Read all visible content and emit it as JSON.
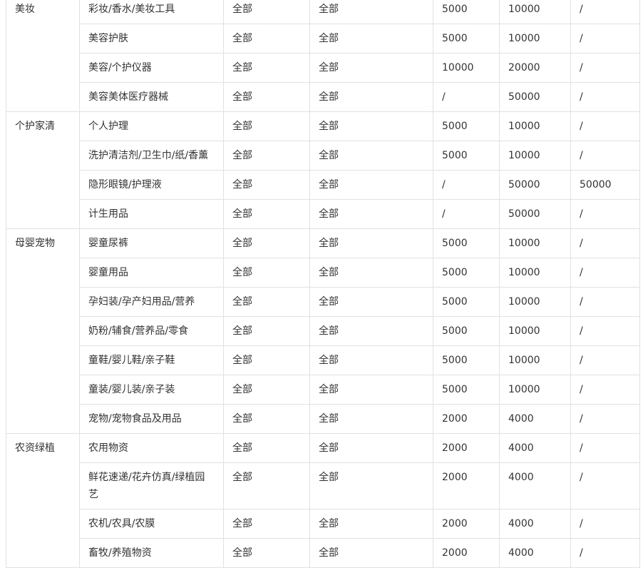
{
  "table": {
    "groups": [
      {
        "category": "美妆",
        "rows": [
          {
            "sub": "彩妆/香水/美妆工具",
            "a": "全部",
            "b": "全部",
            "c": "5000",
            "d": "10000",
            "e": "/"
          },
          {
            "sub": "美容护肤",
            "a": "全部",
            "b": "全部",
            "c": "5000",
            "d": "10000",
            "e": "/"
          },
          {
            "sub": "美容/个护仪器",
            "a": "全部",
            "b": "全部",
            "c": "10000",
            "d": "20000",
            "e": "/"
          },
          {
            "sub": "美容美体医疗器械",
            "a": "全部",
            "b": "全部",
            "c": "/",
            "d": "50000",
            "e": "/"
          }
        ]
      },
      {
        "category": "个护家清",
        "rows": [
          {
            "sub": "个人护理",
            "a": "全部",
            "b": "全部",
            "c": "5000",
            "d": "10000",
            "e": "/"
          },
          {
            "sub": "洗护清洁剂/卫生巾/纸/香薰",
            "a": "全部",
            "b": "全部",
            "c": "5000",
            "d": "10000",
            "e": "/"
          },
          {
            "sub": "隐形眼镜/护理液",
            "a": "全部",
            "b": "全部",
            "c": "/",
            "d": "50000",
            "e": "50000"
          },
          {
            "sub": "计生用品",
            "a": "全部",
            "b": "全部",
            "c": "/",
            "d": "50000",
            "e": "/"
          }
        ]
      },
      {
        "category": "母婴宠物",
        "rows": [
          {
            "sub": "婴童尿裤",
            "a": "全部",
            "b": "全部",
            "c": "5000",
            "d": "10000",
            "e": "/"
          },
          {
            "sub": "婴童用品",
            "a": "全部",
            "b": "全部",
            "c": "5000",
            "d": "10000",
            "e": "/"
          },
          {
            "sub": "孕妇装/孕产妇用品/营养",
            "a": "全部",
            "b": "全部",
            "c": "5000",
            "d": "10000",
            "e": "/"
          },
          {
            "sub": "奶粉/辅食/营养品/零食",
            "a": "全部",
            "b": "全部",
            "c": "5000",
            "d": "10000",
            "e": "/"
          },
          {
            "sub": "童鞋/婴儿鞋/亲子鞋",
            "a": "全部",
            "b": "全部",
            "c": "5000",
            "d": "10000",
            "e": "/"
          },
          {
            "sub": "童装/婴儿装/亲子装",
            "a": "全部",
            "b": "全部",
            "c": "5000",
            "d": "10000",
            "e": "/"
          },
          {
            "sub": "宠物/宠物食品及用品",
            "a": "全部",
            "b": "全部",
            "c": "2000",
            "d": "4000",
            "e": "/"
          }
        ]
      },
      {
        "category": "农资绿植",
        "rows": [
          {
            "sub": "农用物资",
            "a": "全部",
            "b": "全部",
            "c": "2000",
            "d": "4000",
            "e": "/"
          },
          {
            "sub": "鲜花速递/花卉仿真/绿植园艺",
            "a": "全部",
            "b": "全部",
            "c": "2000",
            "d": "4000",
            "e": "/"
          },
          {
            "sub": "农机/农具/农膜",
            "a": "全部",
            "b": "全部",
            "c": "2000",
            "d": "4000",
            "e": "/"
          },
          {
            "sub": "畜牧/养殖物资",
            "a": "全部",
            "b": "全部",
            "c": "2000",
            "d": "4000",
            "e": "/"
          }
        ]
      }
    ]
  }
}
